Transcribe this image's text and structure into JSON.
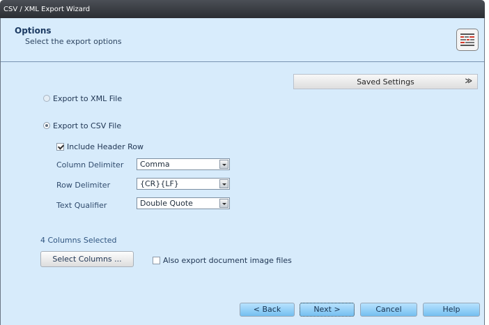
{
  "window": {
    "title": "CSV / XML Export Wizard"
  },
  "header": {
    "title": "Options",
    "subtitle": "Select the export options",
    "icon": "options-document-icon"
  },
  "saved_settings": {
    "label": "Saved Settings"
  },
  "export_options": {
    "xml": {
      "label": "Export to XML File",
      "selected": false
    },
    "csv": {
      "label": "Export to CSV File",
      "selected": true
    }
  },
  "csv_settings": {
    "include_header": {
      "label": "Include Header Row",
      "checked": true
    },
    "column_delimiter": {
      "label": "Column Delimiter",
      "value": "Comma"
    },
    "row_delimiter": {
      "label": "Row Delimiter",
      "value": "{CR}{LF}"
    },
    "text_qualifier": {
      "label": "Text Qualifier",
      "value": "Double Quote"
    }
  },
  "columns": {
    "selected_text": "4 Columns Selected",
    "button_label": "Select Columns ...",
    "export_images_label": "Also export document image files",
    "export_images_checked": false
  },
  "navigation": {
    "back": "< Back",
    "next": "Next >",
    "cancel": "Cancel",
    "help": "Help"
  },
  "colors": {
    "background": "#d7ebfb",
    "button": "#74bff0",
    "titlebar": "#2b2e33"
  }
}
